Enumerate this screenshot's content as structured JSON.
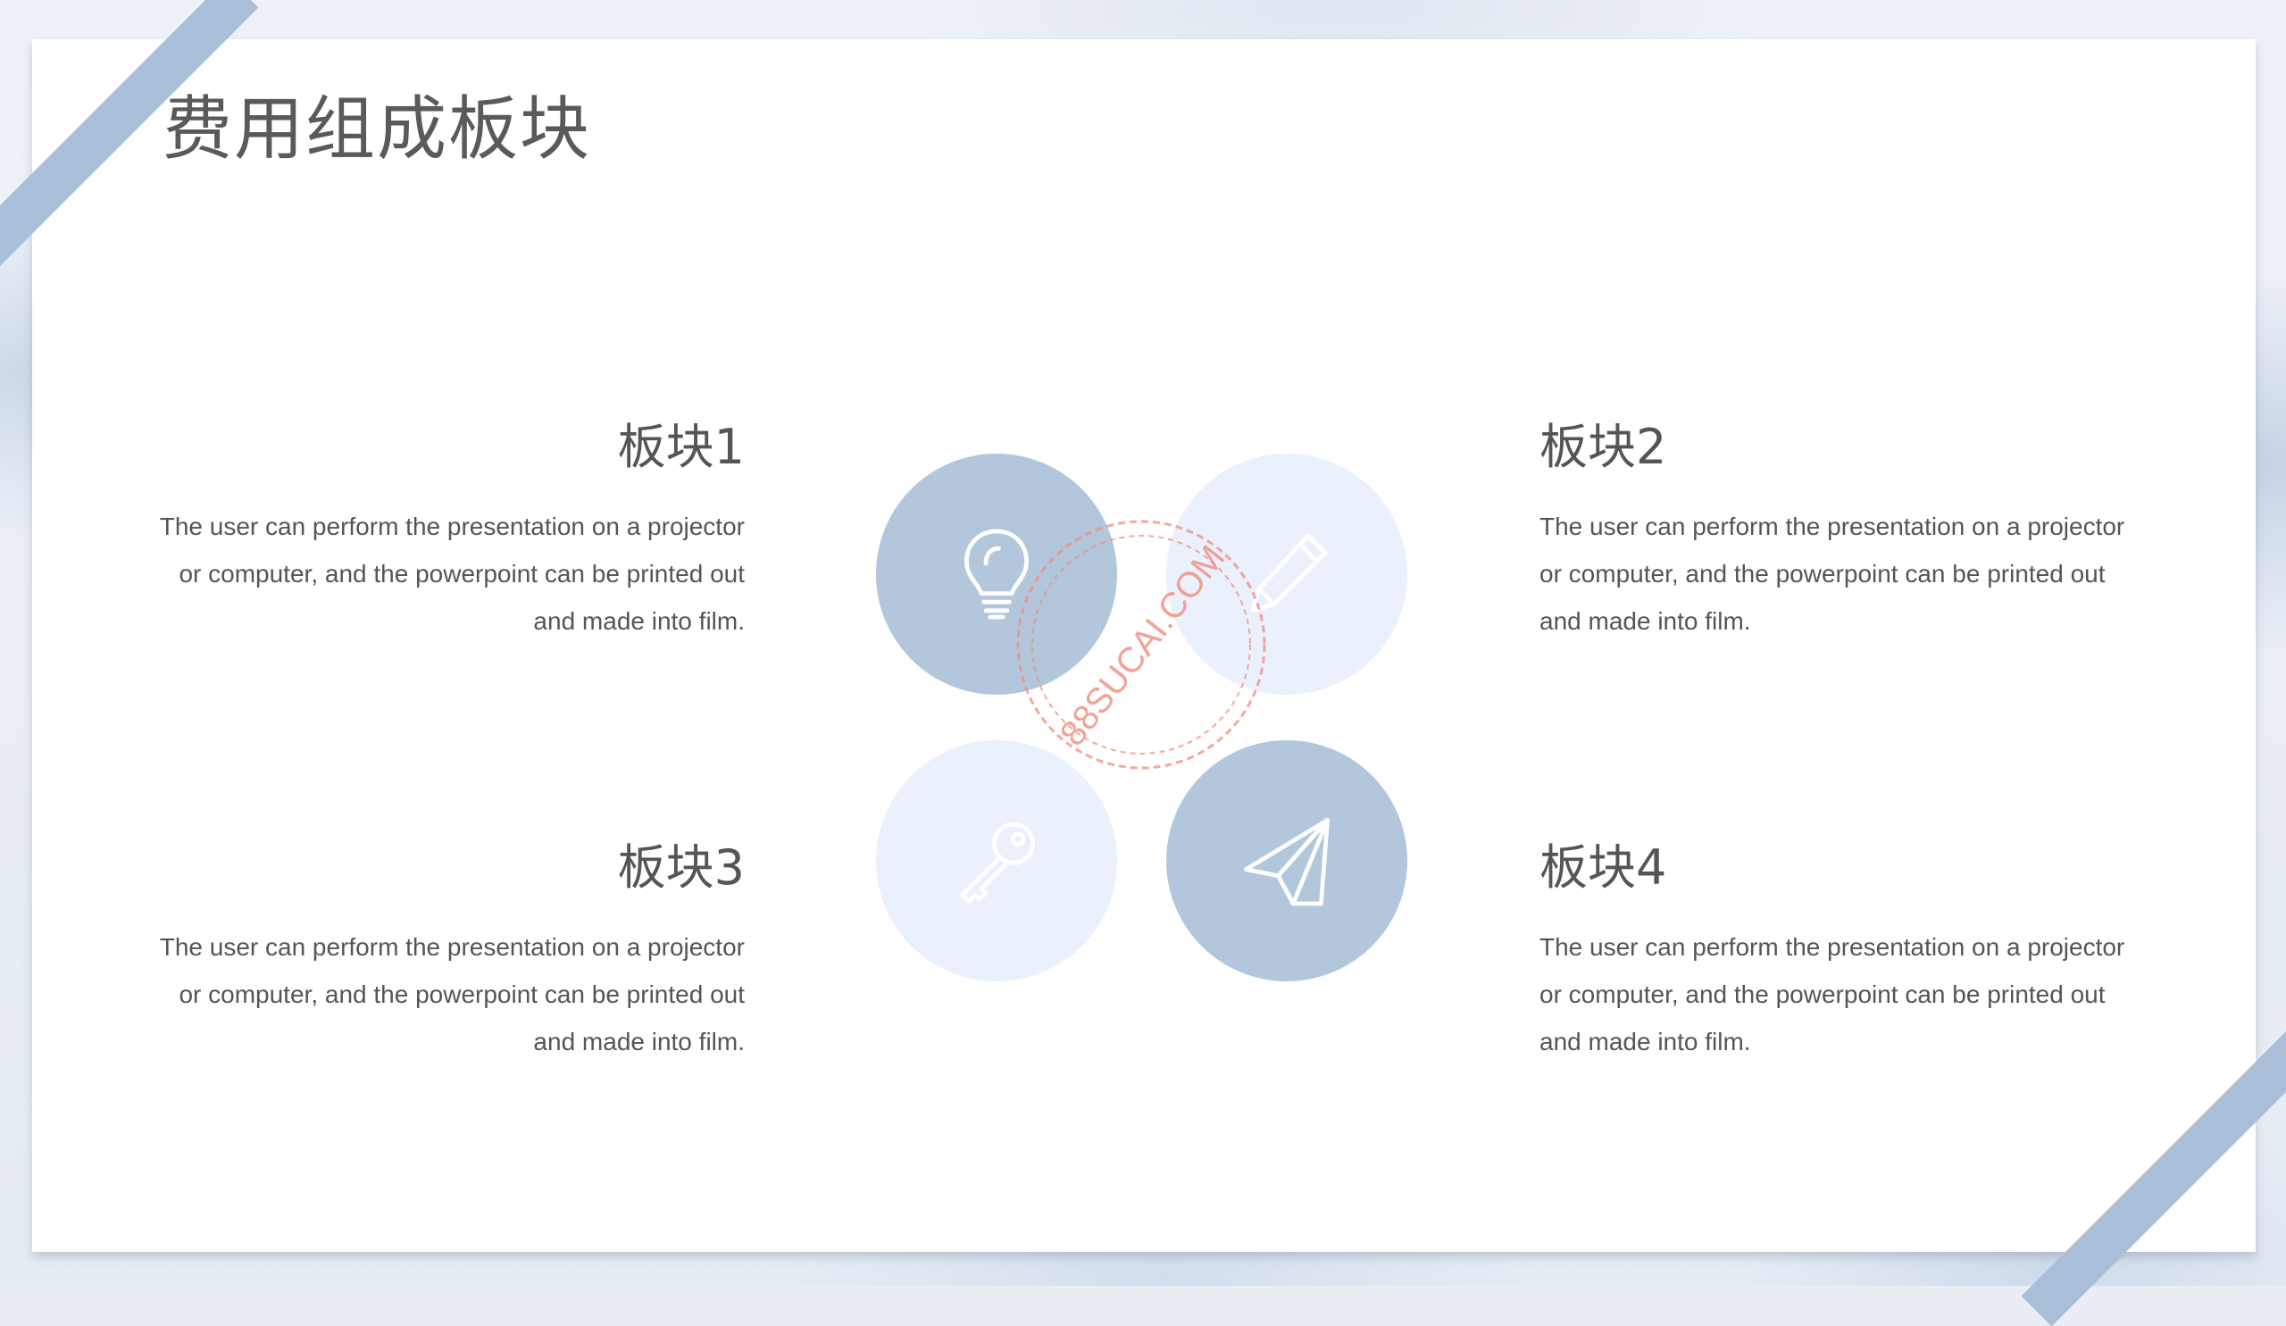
{
  "page": {
    "title": "费用组成板块"
  },
  "blocks": [
    {
      "title": "板块1",
      "text": "The user can perform the presentation on a projector or computer, and the powerpoint can be printed out and made into film."
    },
    {
      "title": "板块2",
      "text": "The user can perform the presentation on a projector or computer, and the powerpoint can be printed out and made into film."
    },
    {
      "title": "板块3",
      "text": "The user can perform the presentation on a projector or computer, and the powerpoint can be printed out and made into film."
    },
    {
      "title": "板块4",
      "text": "The user can perform the presentation on a projector or computer, and the powerpoint can be printed out and made into film."
    }
  ],
  "icons": [
    "lightbulb-icon",
    "pencil-icon",
    "key-icon",
    "paper-plane-icon"
  ],
  "watermark": {
    "text": "88SUCAI.COM"
  },
  "colors": {
    "accent_dark": "#b2c7dc",
    "accent_light": "#eaf1fd",
    "stripe": "#a9bfd9",
    "text": "#555555",
    "watermark": "#f08c7d"
  }
}
